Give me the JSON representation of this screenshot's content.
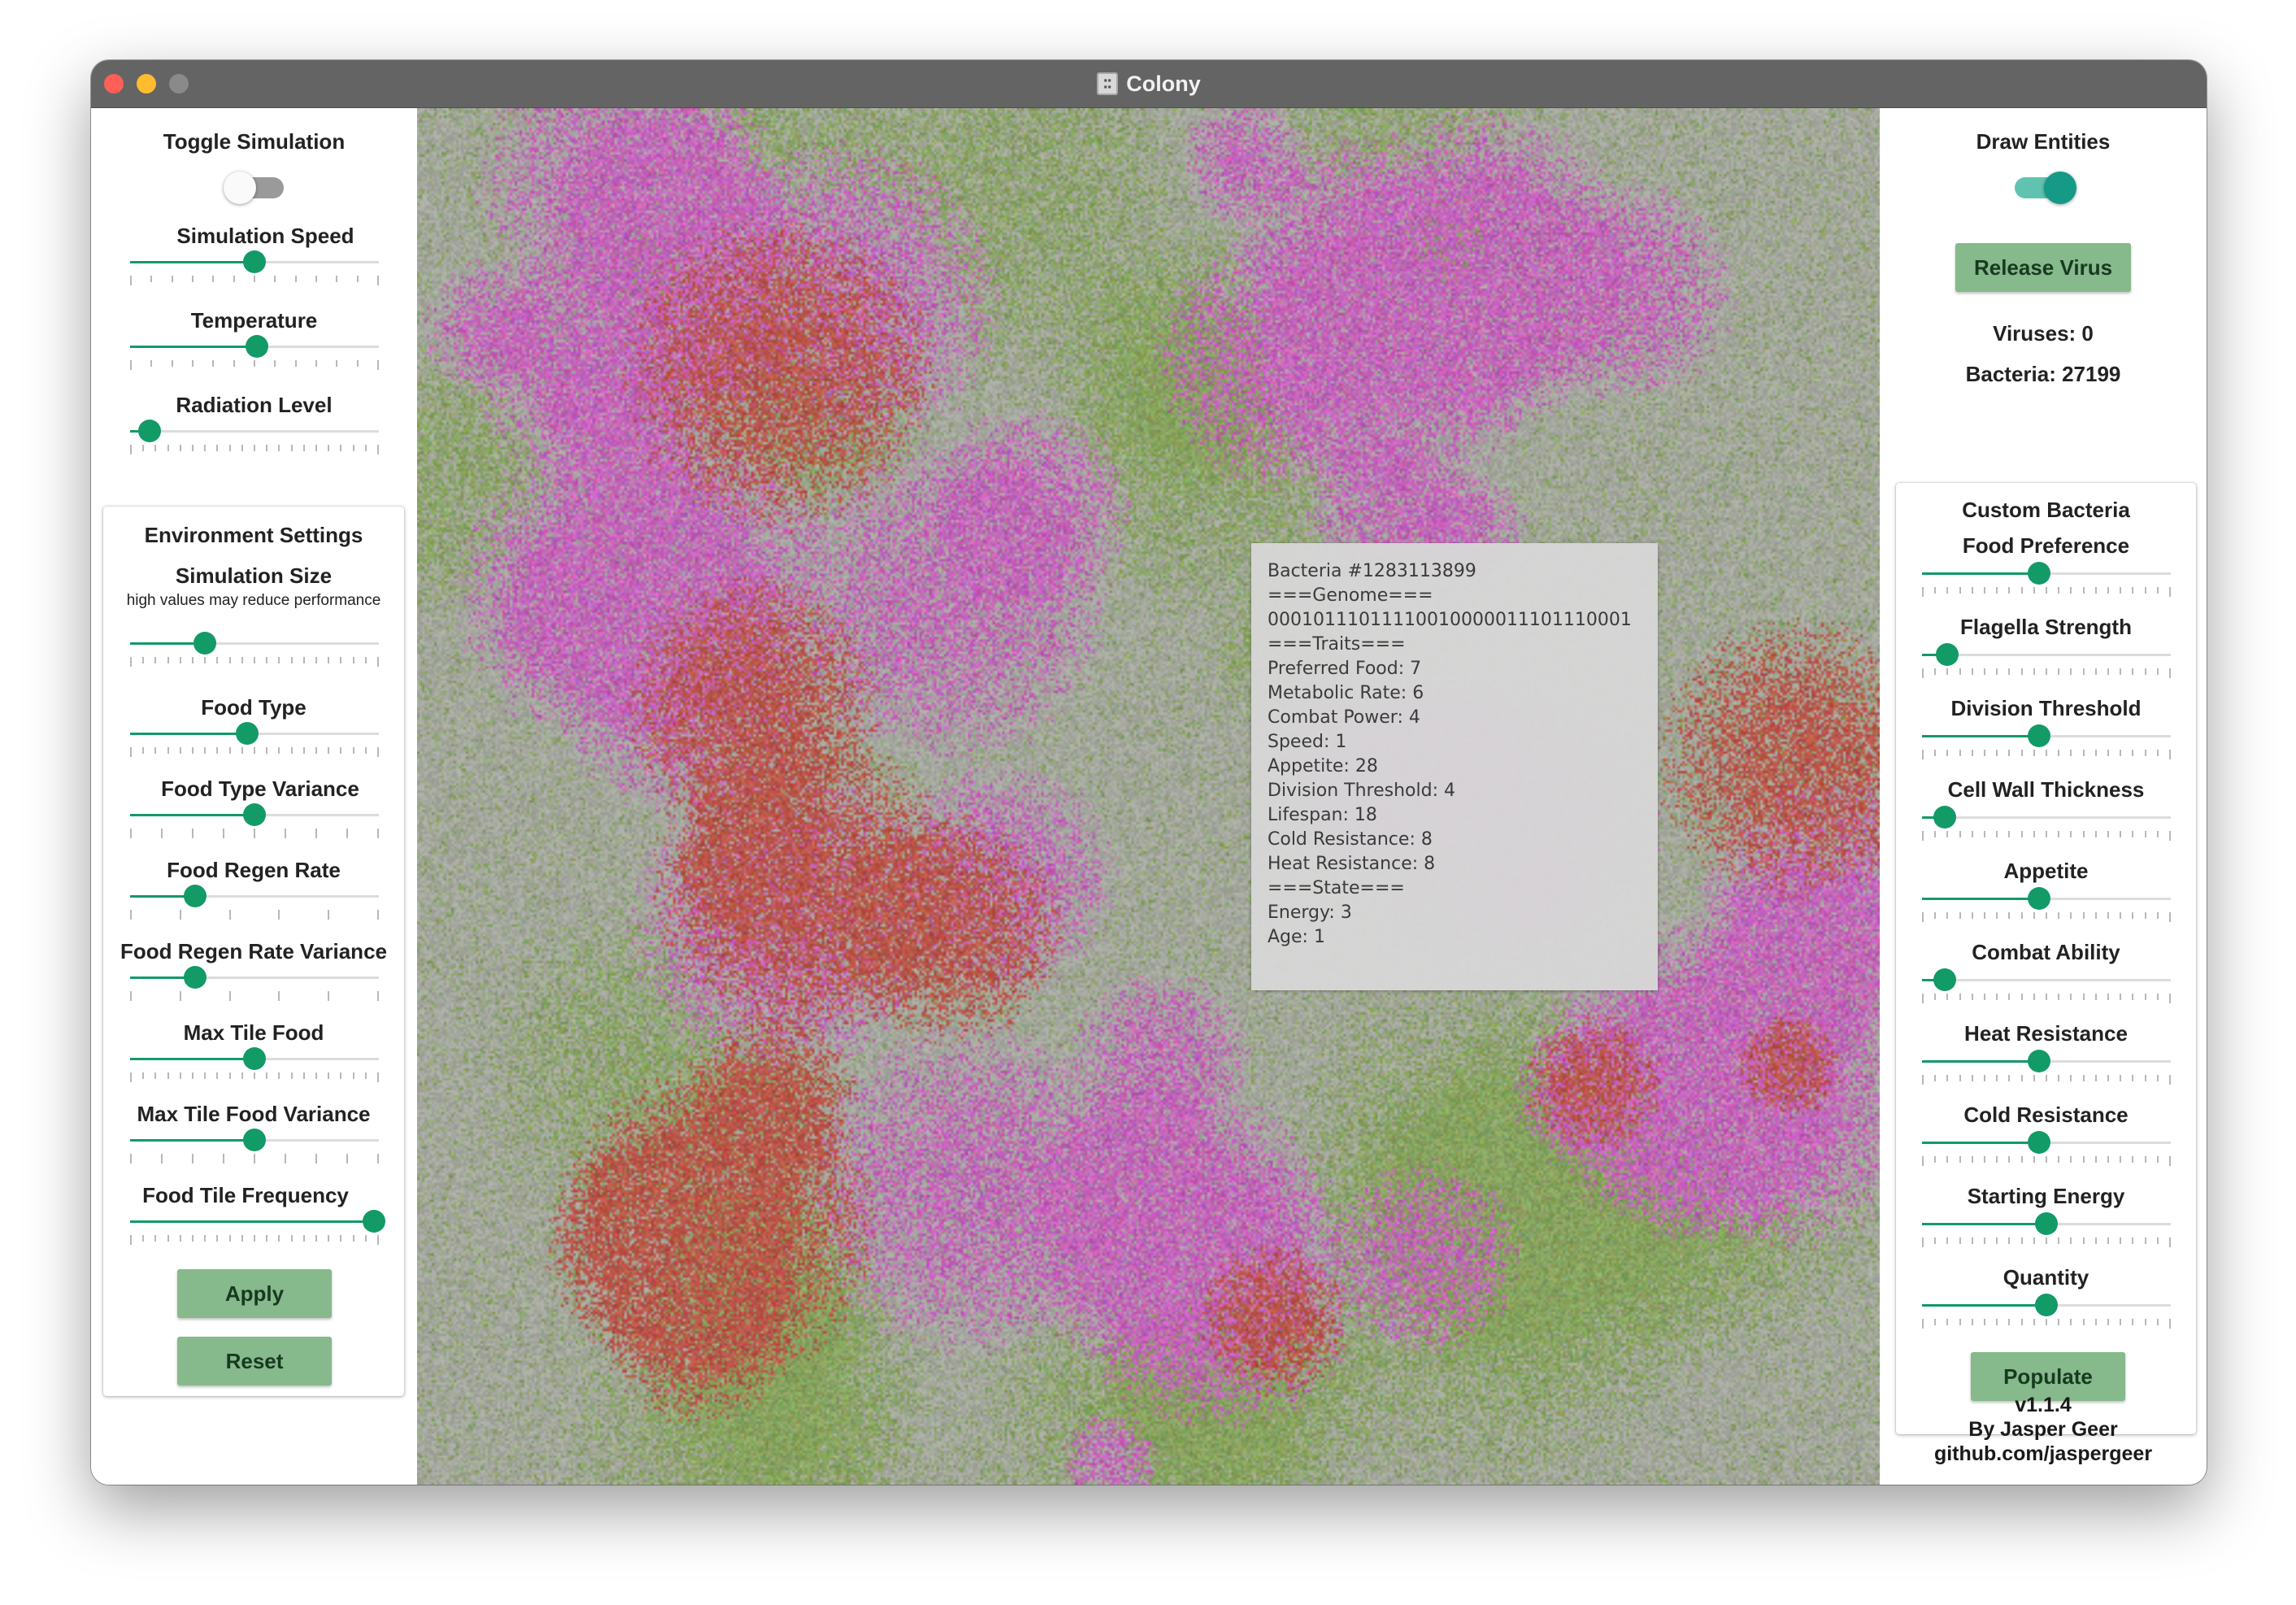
{
  "window": {
    "title": "Colony",
    "app_icon": "colony-icon"
  },
  "left_panel": {
    "toggle_simulation": {
      "label": "Toggle Simulation",
      "on": false
    },
    "simulation_speed": {
      "label": "Simulation Speed",
      "value": 0.5
    },
    "temperature": {
      "label": "Temperature",
      "value": 0.51
    },
    "radiation_level": {
      "label": "Radiation Level",
      "value": 0.08
    },
    "environment_settings": {
      "title": "Environment Settings",
      "sliders": [
        {
          "label": "Simulation Size",
          "sublabel": "high values may reduce performance",
          "value": 0.3
        },
        {
          "label": "Food Type",
          "value": 0.47
        },
        {
          "label": "Food Type Variance",
          "value": 0.5
        },
        {
          "label": "Food Regen Rate",
          "value": 0.26
        },
        {
          "label": "Food Regen Rate Variance",
          "value": 0.26
        },
        {
          "label": "Max Tile Food",
          "value": 0.5
        },
        {
          "label": "Max Tile Food Variance",
          "value": 0.5
        },
        {
          "label": "Food Tile Frequency",
          "value": 0.98
        }
      ],
      "apply_label": "Apply",
      "reset_label": "Reset"
    }
  },
  "right_panel": {
    "draw_entities": {
      "label": "Draw Entities",
      "on": true
    },
    "release_virus_label": "Release Virus",
    "viruses_text": "Viruses: 0",
    "bacteria_text": "Bacteria: 27199",
    "custom_bacteria": {
      "title": "Custom Bacteria",
      "sliders": [
        {
          "label": "Food Preference",
          "value": 0.47
        },
        {
          "label": "Flagella Strength",
          "value": 0.1
        },
        {
          "label": "Division Threshold",
          "value": 0.47
        },
        {
          "label": "Cell Wall Thickness",
          "value": 0.09
        },
        {
          "label": "Appetite",
          "value": 0.47
        },
        {
          "label": "Combat Ability",
          "value": 0.09
        },
        {
          "label": "Heat Resistance",
          "value": 0.47
        },
        {
          "label": "Cold Resistance",
          "value": 0.47
        },
        {
          "label": "Starting Energy",
          "value": 0.5
        },
        {
          "label": "Quantity",
          "value": 0.5
        }
      ],
      "populate_label": "Populate"
    },
    "footer": {
      "version": "v1.1.4",
      "author": "By Jasper Geer",
      "repo": "github.com/jaspergeer"
    }
  },
  "inspector": {
    "lines": [
      "Bacteria #1283113899",
      "===Genome===",
      "00010111011110010000011101110001",
      "===Traits===",
      "Preferred Food: 7",
      "Metabolic Rate: 6",
      "Combat Power: 4",
      "Speed: 1",
      "Appetite: 28",
      "Division Threshold: 4",
      "Lifespan: 18",
      "Cold Resistance: 8",
      "Heat Resistance: 8",
      "===State===",
      "Energy: 3",
      "Age: 1"
    ]
  },
  "colors": {
    "accent": "#129a67",
    "button_bg": "#86b98c",
    "toggle_on": "#149a86",
    "food_green": "#7c9a4c",
    "bacteria_magenta": "#b45aa8",
    "bacteria_red": "#b04a3a"
  }
}
